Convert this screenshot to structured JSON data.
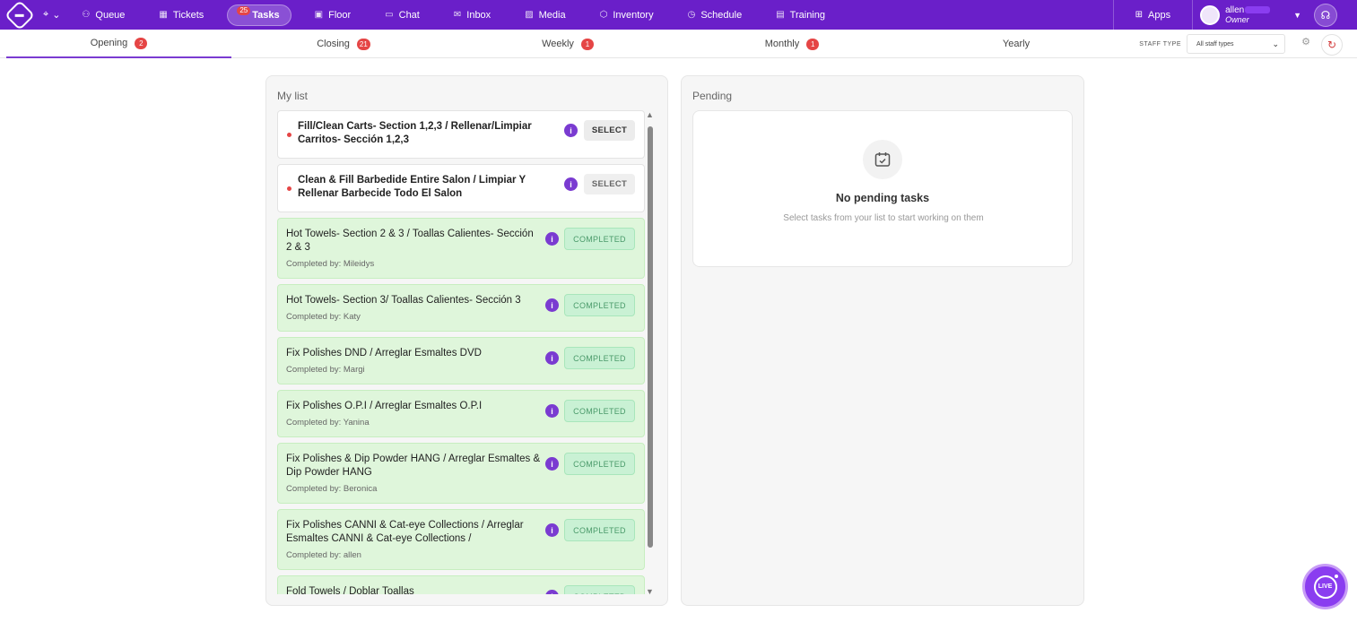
{
  "nav": {
    "items": [
      {
        "label": "Queue",
        "icon": "users-icon"
      },
      {
        "label": "Tickets",
        "icon": "calendar-icon"
      },
      {
        "label": "Tasks",
        "icon": "tasks-icon",
        "badge": "25",
        "active": true
      },
      {
        "label": "Floor",
        "icon": "floor-icon"
      },
      {
        "label": "Chat",
        "icon": "chat-icon"
      },
      {
        "label": "Inbox",
        "icon": "mail-icon"
      },
      {
        "label": "Media",
        "icon": "image-icon"
      },
      {
        "label": "Inventory",
        "icon": "box-icon"
      },
      {
        "label": "Schedule",
        "icon": "clock-icon"
      },
      {
        "label": "Training",
        "icon": "book-icon"
      }
    ],
    "apps_label": "Apps",
    "user": {
      "name": "allen",
      "role": "Owner"
    }
  },
  "tabs": [
    {
      "label": "Opening",
      "badge": "2",
      "active": true
    },
    {
      "label": "Closing",
      "badge": "21"
    },
    {
      "label": "Weekly",
      "badge": "1"
    },
    {
      "label": "Monthly",
      "badge": "1"
    },
    {
      "label": "Yearly",
      "badge": ""
    }
  ],
  "staff_type": {
    "label": "STAFF TYPE",
    "value": "All staff types"
  },
  "my_list": {
    "title": "My list",
    "tasks": [
      {
        "title": "Fill/Clean Carts- Section 1,2,3 / Rellenar/Limpiar Carritos- Sección 1,2,3",
        "status": "open",
        "action": "SELECT"
      },
      {
        "title": "Clean & Fill Barbedide Entire Salon / Limpiar Y Rellenar Barbecide Todo El Salon",
        "status": "open",
        "action": "SELECT"
      },
      {
        "title": "Hot Towels- Section 2 & 3 / Toallas Calientes- Sección 2 & 3",
        "status": "done",
        "action": "COMPLETED",
        "completed_by": "Completed by: Mileidys"
      },
      {
        "title": "Hot Towels- Section 3/ Toallas Calientes- Sección 3",
        "status": "done",
        "action": "COMPLETED",
        "completed_by": "Completed by: Katy"
      },
      {
        "title": "Fix Polishes DND / Arreglar Esmaltes DVD",
        "status": "done",
        "action": "COMPLETED",
        "completed_by": "Completed by: Margi"
      },
      {
        "title": "Fix Polishes O.P.I / Arreglar Esmaltes O.P.I",
        "status": "done",
        "action": "COMPLETED",
        "completed_by": "Completed by: Yanina"
      },
      {
        "title": "Fix Polishes & Dip Powder HANG / Arreglar Esmaltes & Dip Powder HANG",
        "status": "done",
        "action": "COMPLETED",
        "completed_by": "Completed by: Beronica"
      },
      {
        "title": "Fix Polishes CANNI & Cat-eye Collections / Arreglar Esmaltes CANNI & Cat-eye Collections /",
        "status": "done",
        "action": "COMPLETED",
        "completed_by": "Completed by: allen"
      },
      {
        "title": "Fold Towels / Doblar Toallas",
        "status": "done",
        "action": "COMPLETED",
        "completed_by": ""
      }
    ]
  },
  "pending": {
    "title": "Pending",
    "empty_title": "No pending tasks",
    "empty_sub": "Select tasks from your list to start working on them"
  },
  "live_label": "LIVE",
  "colors": {
    "brand": "#6a1fc9",
    "accent": "#7a3bd1",
    "badge": "#e54545",
    "completed_bg": "#dff6db"
  }
}
